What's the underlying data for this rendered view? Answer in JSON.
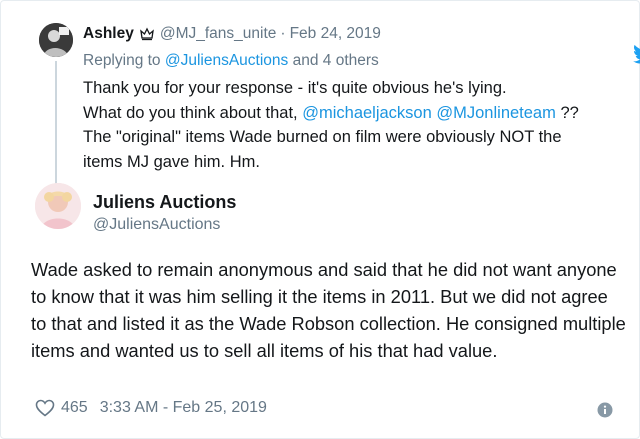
{
  "reply_tweet": {
    "name": "Ashley",
    "handle": "@MJ_fans_unite",
    "separator": "·",
    "date": "Feb 24, 2019",
    "replying_prefix": "Replying to ",
    "replying_to": "@JuliensAuctions",
    "replying_suffix": " and 4 others",
    "line1": "Thank you for your response - it's quite obvious he's lying.",
    "line2_prefix": "What do you think about that, ",
    "mention1": "@michaeljackson",
    "mention2": "@MJonlineteam",
    "line2_suffix": " ??",
    "line3": "The \"original\" items Wade burned on film were obviously NOT the",
    "line4": "items MJ gave him. Hm."
  },
  "main_tweet": {
    "name": "Juliens Auctions",
    "handle": "@JuliensAuctions",
    "body": "Wade asked to remain anonymous and said that he did not want anyone to know that it was him selling it the items in 2011. But we did not agree to that and listed it as the Wade Robson collection. He consigned multiple items and wanted us to sell all items of his that had value.",
    "likes": "465",
    "timestamp": "3:33 AM - Feb 25, 2019"
  },
  "icons": {
    "brand": "twitter-bird-icon",
    "like": "heart-icon",
    "info": "info-icon",
    "badge": "crown-icon"
  },
  "colors": {
    "link": "#1b95e0",
    "muted": "#657786",
    "text": "#14171a",
    "twitter_blue": "#1da1f2"
  }
}
